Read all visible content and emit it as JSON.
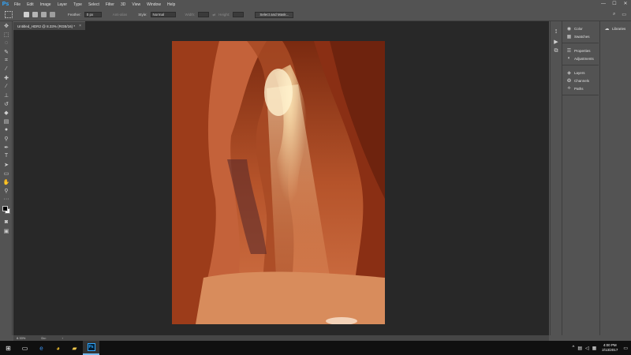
{
  "app": {
    "logo": "Ps"
  },
  "menu": [
    "File",
    "Edit",
    "Image",
    "Layer",
    "Type",
    "Select",
    "Filter",
    "3D",
    "View",
    "Window",
    "Help"
  ],
  "window_controls": {
    "minimize": "—",
    "maximize": "☐",
    "close": "✕"
  },
  "options": {
    "feather_label": "Feather:",
    "feather_value": "0 px",
    "antialias_label": "Anti-alias",
    "style_label": "Style:",
    "style_value": "Normal",
    "width_label": "Width:",
    "height_label": "Height:",
    "select_mask_label": "Select and Mask..."
  },
  "document": {
    "tab_title": "Untitled_HDR2 @ 8.33% (RGB/16) *",
    "close": "×"
  },
  "status": {
    "zoom": "8.33%",
    "doc": "Do:"
  },
  "panels": {
    "group1": [
      {
        "label": "Color",
        "icon": "color-wheel-icon"
      },
      {
        "label": "Swatches",
        "icon": "swatches-grid-icon"
      }
    ],
    "group2": [
      {
        "label": "Properties",
        "icon": "properties-sliders-icon"
      },
      {
        "label": "Adjustments",
        "icon": "adjustments-icon"
      }
    ],
    "group3": [
      {
        "label": "Layers",
        "icon": "layers-stack-icon"
      },
      {
        "label": "Channels",
        "icon": "channels-icon"
      },
      {
        "label": "Paths",
        "icon": "paths-pen-icon"
      }
    ],
    "libraries": "Libraries"
  },
  "taskbar": {
    "time": "4:00 PM",
    "date": "2/13/2017"
  }
}
